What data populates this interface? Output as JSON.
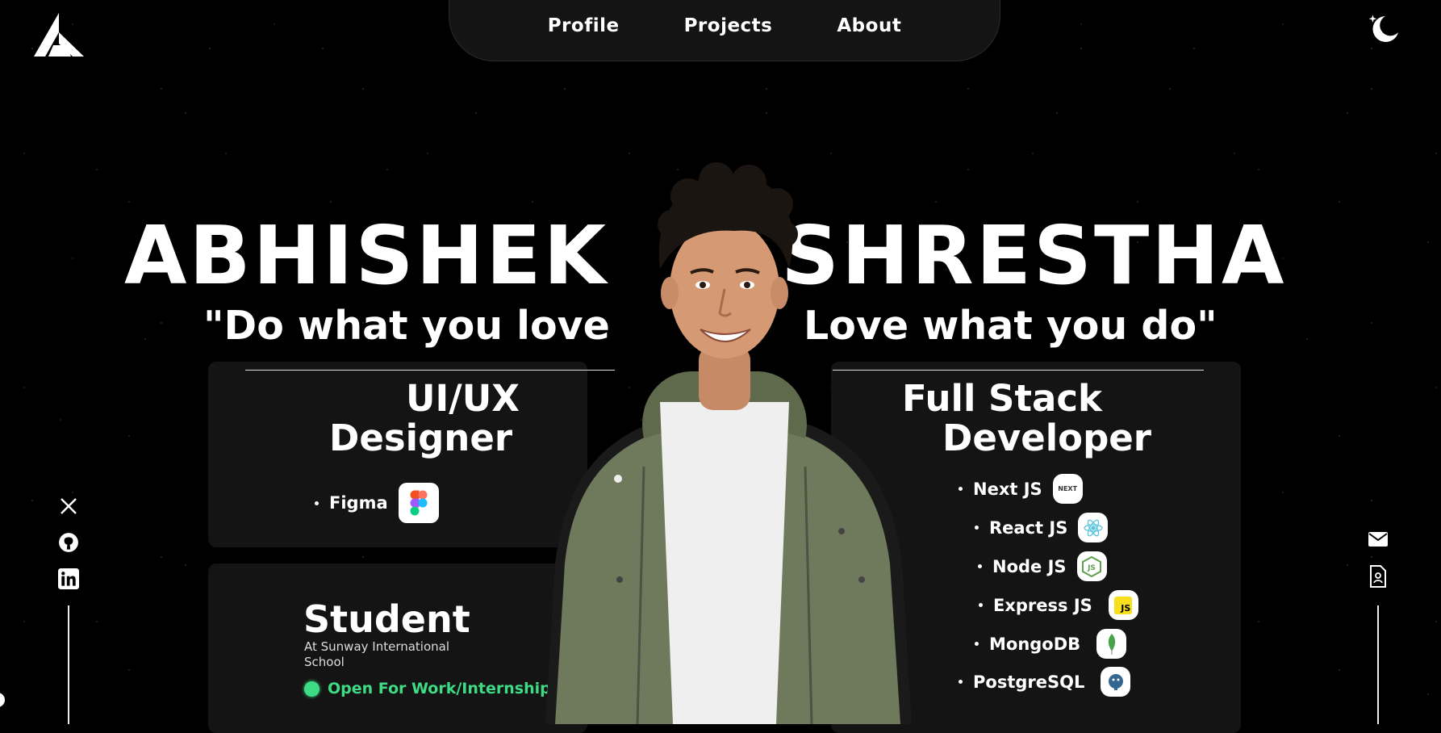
{
  "nav": {
    "items": [
      {
        "label": "Profile"
      },
      {
        "label": "Projects"
      },
      {
        "label": "About"
      }
    ]
  },
  "hero": {
    "first_name": "ABHISHEK",
    "last_name": "SHRESTHA",
    "quote_left": "\"Do what you love",
    "quote_right": "Love what you do\""
  },
  "roles": {
    "designer": {
      "line1": "UI/UX",
      "line2": "Designer",
      "skills": [
        {
          "label": "Figma",
          "icon": "figma-icon"
        }
      ]
    },
    "developer": {
      "line1": "Full Stack",
      "line2": "Developer",
      "skills": [
        {
          "label": "Next JS",
          "icon": "nextjs-icon"
        },
        {
          "label": "React JS",
          "icon": "react-icon"
        },
        {
          "label": "Node JS",
          "icon": "nodejs-icon"
        },
        {
          "label": "Express JS",
          "icon": "js-icon"
        },
        {
          "label": "MongoDB",
          "icon": "mongodb-icon"
        },
        {
          "label": "PostgreSQL",
          "icon": "postgresql-icon"
        }
      ]
    }
  },
  "student": {
    "title": "Student",
    "subtitle": "At Sunway International School",
    "status": "Open For Work/Internship",
    "status_color": "#3ddc84"
  },
  "icons": {
    "logo": "logo-icon",
    "theme": "moon-icon",
    "socials": [
      "x-icon",
      "github-icon",
      "linkedin-icon"
    ],
    "right": [
      "mail-icon",
      "resume-icon"
    ]
  }
}
